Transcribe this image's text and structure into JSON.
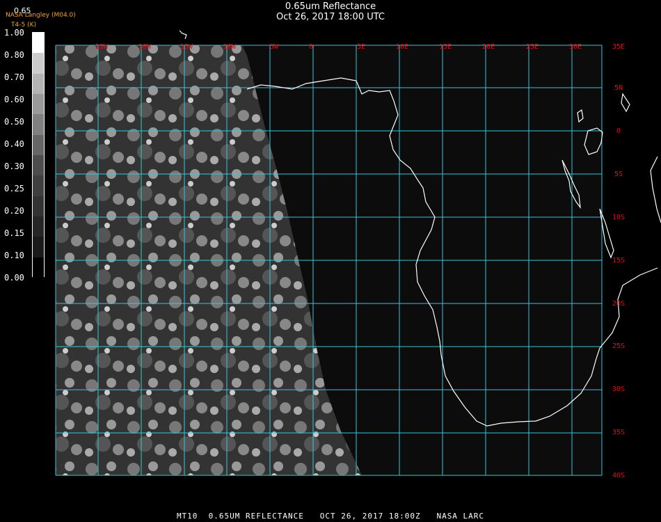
{
  "header": {
    "title": "0.65um Reflectance",
    "subtitle": "Oct 26, 2017 18:00 UTC",
    "credit": "NASA Langley (M04.0)",
    "credit2": "T4-5 (K)",
    "small_value": "0.65"
  },
  "colorbar": {
    "labels": [
      "1.00",
      "0.80",
      "0.70",
      "0.60",
      "0.50",
      "0.40",
      "0.30",
      "0.25",
      "0.20",
      "0.15",
      "0.10",
      "0.00"
    ],
    "levels": [
      1.0,
      0.8,
      0.7,
      0.6,
      0.5,
      0.4,
      0.3,
      0.25,
      0.2,
      0.15,
      0.1,
      0.0
    ]
  },
  "map": {
    "lon_labels": [
      "25W",
      "20W",
      "15W",
      "10W",
      "5W",
      "0",
      "5E",
      "10E",
      "15E",
      "20E",
      "25E",
      "30E",
      "35E"
    ],
    "lat_labels": [
      "5N",
      "0",
      "5S",
      "10S",
      "15S",
      "20S",
      "25S",
      "30S",
      "35S",
      "40S"
    ],
    "colors": {
      "grid": "#38c8d8",
      "coast": "#ffffff",
      "label": "#cc1111",
      "background": "#0c0c0c"
    }
  },
  "footer": {
    "text": "MT10  0.65UM REFLECTANCE   OCT 26, 2017 18:00Z   NASA LARC"
  }
}
